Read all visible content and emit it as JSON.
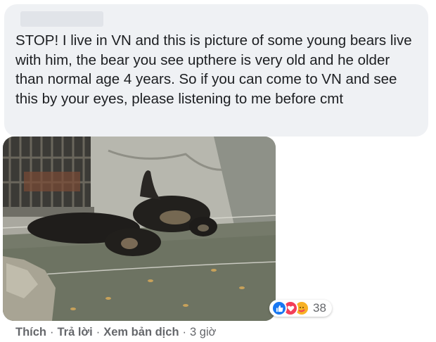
{
  "comment": {
    "text": "STOP! I live in VN and this is picture of some young bears live with him, the bear you see upthere is very old and he older than normal age 4 years. So if you can come to VN and see this by your eyes, please listening to me before cmt",
    "photo_icon": "bears-photo",
    "reactions": {
      "icons": [
        "like-icon",
        "love-icon",
        "care-icon"
      ],
      "count": "38"
    }
  },
  "actions": {
    "like": "Thích",
    "reply": "Trả lời",
    "translate": "Xem bản dịch",
    "separator": "·",
    "time": "3 giờ"
  },
  "colors": {
    "bubble": "#eff1f4",
    "text": "#1c1e21",
    "meta": "#65676b",
    "like": "#1877f2",
    "love": "#f33e58",
    "care": "#f7b125"
  }
}
